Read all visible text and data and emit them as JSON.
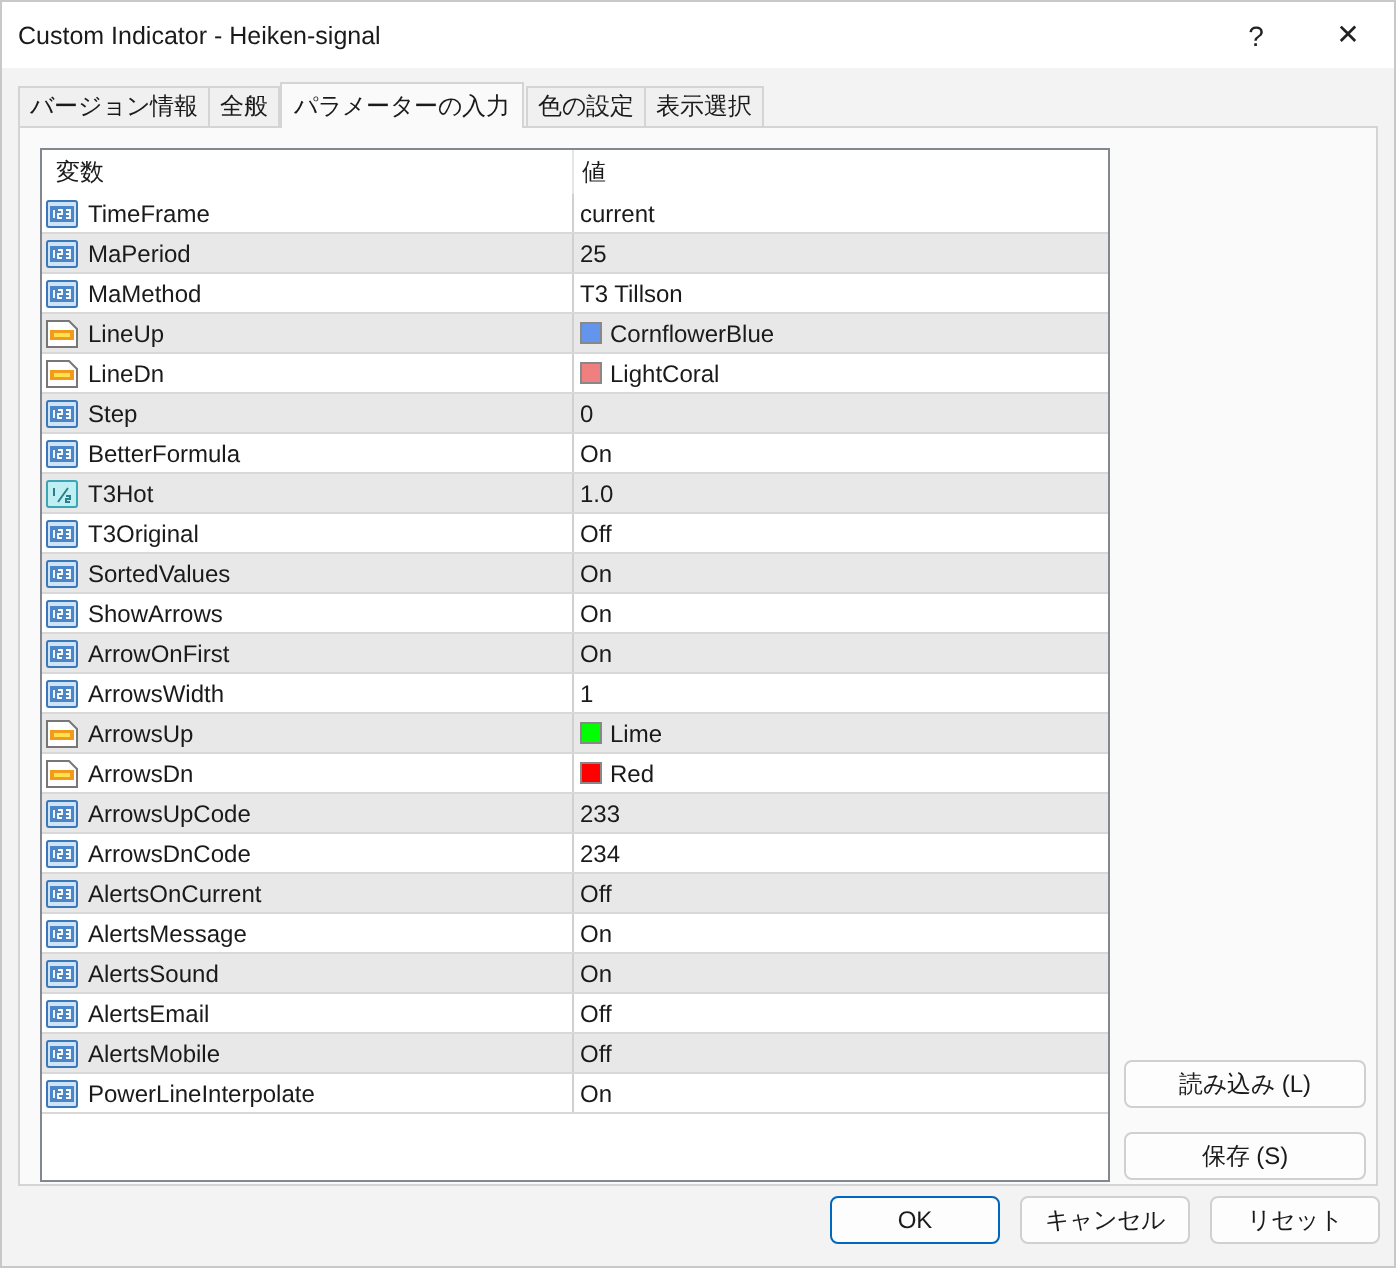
{
  "window": {
    "title": "Custom Indicator - Heiken-signal",
    "help": "?",
    "close": "✕"
  },
  "tabs": [
    {
      "label": "バージョン情報",
      "selected": false
    },
    {
      "label": "全般",
      "selected": false
    },
    {
      "label": "パラメーターの入力",
      "selected": true
    },
    {
      "label": "色の設定",
      "selected": false
    },
    {
      "label": "表示選択",
      "selected": false
    }
  ],
  "table": {
    "columns": [
      "変数",
      "値"
    ],
    "rows": [
      {
        "kind": "int",
        "name": "TimeFrame",
        "value": "current"
      },
      {
        "kind": "int",
        "name": "MaPeriod",
        "value": "25"
      },
      {
        "kind": "int",
        "name": "MaMethod",
        "value": "T3 Tillson"
      },
      {
        "kind": "color",
        "name": "LineUp",
        "value": "CornflowerBlue",
        "color": "#6495ed"
      },
      {
        "kind": "color",
        "name": "LineDn",
        "value": "LightCoral",
        "color": "#f08080"
      },
      {
        "kind": "int",
        "name": "Step",
        "value": "0"
      },
      {
        "kind": "int",
        "name": "BetterFormula",
        "value": "On"
      },
      {
        "kind": "double",
        "name": "T3Hot",
        "value": "1.0"
      },
      {
        "kind": "int",
        "name": "T3Original",
        "value": "Off"
      },
      {
        "kind": "int",
        "name": "SortedValues",
        "value": "On"
      },
      {
        "kind": "int",
        "name": "ShowArrows",
        "value": "On"
      },
      {
        "kind": "int",
        "name": "ArrowOnFirst",
        "value": "On"
      },
      {
        "kind": "int",
        "name": "ArrowsWidth",
        "value": "1"
      },
      {
        "kind": "color",
        "name": "ArrowsUp",
        "value": "Lime",
        "color": "#00ff00"
      },
      {
        "kind": "color",
        "name": "ArrowsDn",
        "value": "Red",
        "color": "#ff0000"
      },
      {
        "kind": "int",
        "name": "ArrowsUpCode",
        "value": "233"
      },
      {
        "kind": "int",
        "name": "ArrowsDnCode",
        "value": "234"
      },
      {
        "kind": "int",
        "name": "AlertsOnCurrent",
        "value": "Off"
      },
      {
        "kind": "int",
        "name": "AlertsMessage",
        "value": "On"
      },
      {
        "kind": "int",
        "name": "AlertsSound",
        "value": "On"
      },
      {
        "kind": "int",
        "name": "AlertsEmail",
        "value": "Off"
      },
      {
        "kind": "int",
        "name": "AlertsMobile",
        "value": "Off"
      },
      {
        "kind": "int",
        "name": "PowerLineInterpolate",
        "value": "On"
      }
    ]
  },
  "side_buttons": [
    "読み込み (L)",
    "保存 (S)"
  ],
  "buttons": [
    {
      "label": "OK",
      "kind": "default"
    },
    {
      "label": "キャンセル",
      "kind": "normal"
    },
    {
      "label": "リセット",
      "kind": "normal"
    }
  ]
}
